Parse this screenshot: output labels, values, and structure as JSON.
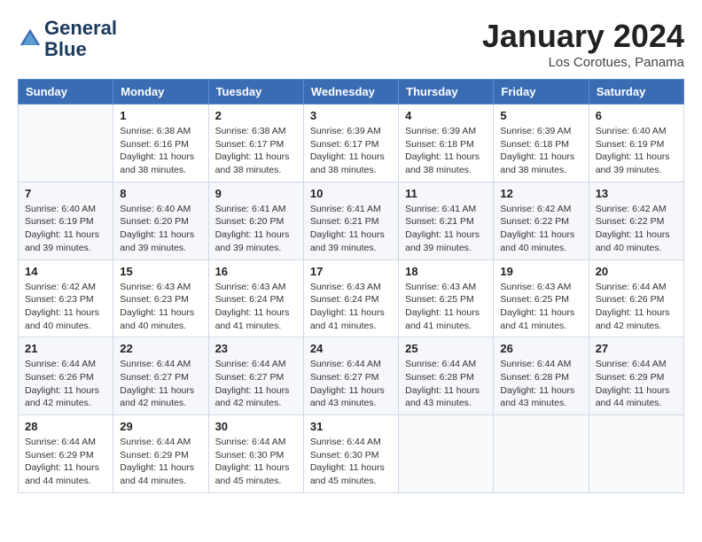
{
  "header": {
    "logo_line1": "General",
    "logo_line2": "Blue",
    "month": "January 2024",
    "location": "Los Corotues, Panama"
  },
  "weekdays": [
    "Sunday",
    "Monday",
    "Tuesday",
    "Wednesday",
    "Thursday",
    "Friday",
    "Saturday"
  ],
  "weeks": [
    [
      {
        "day": "",
        "info": ""
      },
      {
        "day": "1",
        "info": "Sunrise: 6:38 AM\nSunset: 6:16 PM\nDaylight: 11 hours and 38 minutes."
      },
      {
        "day": "2",
        "info": "Sunrise: 6:38 AM\nSunset: 6:17 PM\nDaylight: 11 hours and 38 minutes."
      },
      {
        "day": "3",
        "info": "Sunrise: 6:39 AM\nSunset: 6:17 PM\nDaylight: 11 hours and 38 minutes."
      },
      {
        "day": "4",
        "info": "Sunrise: 6:39 AM\nSunset: 6:18 PM\nDaylight: 11 hours and 38 minutes."
      },
      {
        "day": "5",
        "info": "Sunrise: 6:39 AM\nSunset: 6:18 PM\nDaylight: 11 hours and 38 minutes."
      },
      {
        "day": "6",
        "info": "Sunrise: 6:40 AM\nSunset: 6:19 PM\nDaylight: 11 hours and 39 minutes."
      }
    ],
    [
      {
        "day": "7",
        "info": "Sunrise: 6:40 AM\nSunset: 6:19 PM\nDaylight: 11 hours and 39 minutes."
      },
      {
        "day": "8",
        "info": "Sunrise: 6:40 AM\nSunset: 6:20 PM\nDaylight: 11 hours and 39 minutes."
      },
      {
        "day": "9",
        "info": "Sunrise: 6:41 AM\nSunset: 6:20 PM\nDaylight: 11 hours and 39 minutes."
      },
      {
        "day": "10",
        "info": "Sunrise: 6:41 AM\nSunset: 6:21 PM\nDaylight: 11 hours and 39 minutes."
      },
      {
        "day": "11",
        "info": "Sunrise: 6:41 AM\nSunset: 6:21 PM\nDaylight: 11 hours and 39 minutes."
      },
      {
        "day": "12",
        "info": "Sunrise: 6:42 AM\nSunset: 6:22 PM\nDaylight: 11 hours and 40 minutes."
      },
      {
        "day": "13",
        "info": "Sunrise: 6:42 AM\nSunset: 6:22 PM\nDaylight: 11 hours and 40 minutes."
      }
    ],
    [
      {
        "day": "14",
        "info": "Sunrise: 6:42 AM\nSunset: 6:23 PM\nDaylight: 11 hours and 40 minutes."
      },
      {
        "day": "15",
        "info": "Sunrise: 6:43 AM\nSunset: 6:23 PM\nDaylight: 11 hours and 40 minutes."
      },
      {
        "day": "16",
        "info": "Sunrise: 6:43 AM\nSunset: 6:24 PM\nDaylight: 11 hours and 41 minutes."
      },
      {
        "day": "17",
        "info": "Sunrise: 6:43 AM\nSunset: 6:24 PM\nDaylight: 11 hours and 41 minutes."
      },
      {
        "day": "18",
        "info": "Sunrise: 6:43 AM\nSunset: 6:25 PM\nDaylight: 11 hours and 41 minutes."
      },
      {
        "day": "19",
        "info": "Sunrise: 6:43 AM\nSunset: 6:25 PM\nDaylight: 11 hours and 41 minutes."
      },
      {
        "day": "20",
        "info": "Sunrise: 6:44 AM\nSunset: 6:26 PM\nDaylight: 11 hours and 42 minutes."
      }
    ],
    [
      {
        "day": "21",
        "info": "Sunrise: 6:44 AM\nSunset: 6:26 PM\nDaylight: 11 hours and 42 minutes."
      },
      {
        "day": "22",
        "info": "Sunrise: 6:44 AM\nSunset: 6:27 PM\nDaylight: 11 hours and 42 minutes."
      },
      {
        "day": "23",
        "info": "Sunrise: 6:44 AM\nSunset: 6:27 PM\nDaylight: 11 hours and 42 minutes."
      },
      {
        "day": "24",
        "info": "Sunrise: 6:44 AM\nSunset: 6:27 PM\nDaylight: 11 hours and 43 minutes."
      },
      {
        "day": "25",
        "info": "Sunrise: 6:44 AM\nSunset: 6:28 PM\nDaylight: 11 hours and 43 minutes."
      },
      {
        "day": "26",
        "info": "Sunrise: 6:44 AM\nSunset: 6:28 PM\nDaylight: 11 hours and 43 minutes."
      },
      {
        "day": "27",
        "info": "Sunrise: 6:44 AM\nSunset: 6:29 PM\nDaylight: 11 hours and 44 minutes."
      }
    ],
    [
      {
        "day": "28",
        "info": "Sunrise: 6:44 AM\nSunset: 6:29 PM\nDaylight: 11 hours and 44 minutes."
      },
      {
        "day": "29",
        "info": "Sunrise: 6:44 AM\nSunset: 6:29 PM\nDaylight: 11 hours and 44 minutes."
      },
      {
        "day": "30",
        "info": "Sunrise: 6:44 AM\nSunset: 6:30 PM\nDaylight: 11 hours and 45 minutes."
      },
      {
        "day": "31",
        "info": "Sunrise: 6:44 AM\nSunset: 6:30 PM\nDaylight: 11 hours and 45 minutes."
      },
      {
        "day": "",
        "info": ""
      },
      {
        "day": "",
        "info": ""
      },
      {
        "day": "",
        "info": ""
      }
    ]
  ]
}
